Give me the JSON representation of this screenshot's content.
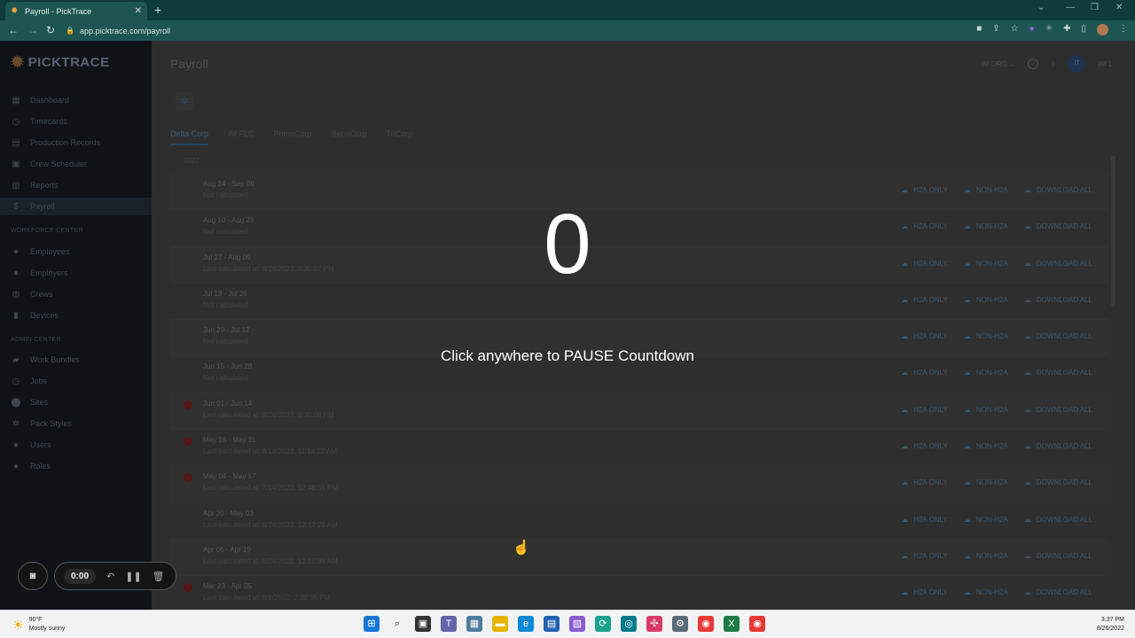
{
  "browser": {
    "tab_title": "Payroll - PickTrace",
    "url": "app.picktrace.com/payroll"
  },
  "sidebar": {
    "logo_text": "PICKTRACE",
    "items": [
      {
        "label": "Dashboard",
        "icon": "dashboard-icon"
      },
      {
        "label": "Timecards",
        "icon": "clock-icon"
      },
      {
        "label": "Production Records",
        "icon": "records-icon"
      },
      {
        "label": "Crew Scheduler",
        "icon": "calendar-icon"
      },
      {
        "label": "Reports",
        "icon": "chart-icon"
      },
      {
        "label": "Payroll",
        "icon": "dollar-icon",
        "active": true
      }
    ],
    "section_workforce": "WORKFORCE CENTER",
    "workforce_items": [
      {
        "label": "Employees",
        "icon": "person-icon"
      },
      {
        "label": "Employers",
        "icon": "person-icon"
      },
      {
        "label": "Crews",
        "icon": "globe-icon"
      },
      {
        "label": "Devices",
        "icon": "phone-icon"
      }
    ],
    "section_admin": "ADMIN CENTER",
    "admin_items": [
      {
        "label": "Work Bundles",
        "icon": "briefcase-icon"
      },
      {
        "label": "Jobs",
        "icon": "clock-icon"
      },
      {
        "label": "Sites",
        "icon": "pin-icon"
      },
      {
        "label": "Pack Styles",
        "icon": "gear-icon"
      },
      {
        "label": "Users",
        "icon": "person-icon"
      },
      {
        "label": "Roles",
        "icon": "person-add-icon"
      }
    ]
  },
  "header": {
    "page_title": "Payroll",
    "org": "IM ORG",
    "user_initials": "IT",
    "user_name": "IM 1"
  },
  "company_tabs": [
    "Delta Corp",
    "IM FLC",
    "PrimoCorp",
    "SecoCorp",
    "TriCorp"
  ],
  "year": "2022",
  "actions": {
    "h2a": "H2A ONLY",
    "non_h2a": "NON-H2A",
    "download": "DOWNLOAD ALL"
  },
  "periods": [
    {
      "range": "Aug 24 - Sep 06",
      "status": "Not calculated",
      "error": false
    },
    {
      "range": "Aug 10 - Aug 23",
      "status": "Not calculated",
      "error": false
    },
    {
      "range": "Jul 27 - Aug 09",
      "status": "Last calculated at: 8/26/2022, 3:30:07 PM",
      "error": false
    },
    {
      "range": "Jul 13 - Jul 26",
      "status": "Not calculated",
      "error": false
    },
    {
      "range": "Jun 29 - Jul 12",
      "status": "Not calculated",
      "error": false
    },
    {
      "range": "Jun 15 - Jun 28",
      "status": "Not calculated",
      "error": false
    },
    {
      "range": "Jun 01 - Jun 14",
      "status": "Last calculated at: 8/26/2022, 3:30:08 PM",
      "error": true
    },
    {
      "range": "May 18 - May 31",
      "status": "Last calculated at: 8/18/2022, 11:14:22 AM",
      "error": true
    },
    {
      "range": "May 04 - May 17",
      "status": "Last calculated at: 7/14/2022, 12:46:51 PM",
      "error": true
    },
    {
      "range": "Apr 20 - May 03",
      "status": "Last calculated at: 6/24/2022, 12:17:29 AM",
      "error": false
    },
    {
      "range": "Apr 06 - Apr 19",
      "status": "Last calculated at: 6/24/2022, 12:17:36 AM",
      "error": false
    },
    {
      "range": "Mar 23 - Apr 05",
      "status": "Last calculated at: 8/8/2022, 2:39:55 PM",
      "error": true
    }
  ],
  "countdown": {
    "number": "0",
    "message": "Click anywhere to PAUSE Countdown"
  },
  "recorder": {
    "time": "0:00"
  },
  "taskbar": {
    "temp": "90°F",
    "condition": "Mostly sunny",
    "time": "3:37 PM",
    "date": "8/26/2022"
  }
}
